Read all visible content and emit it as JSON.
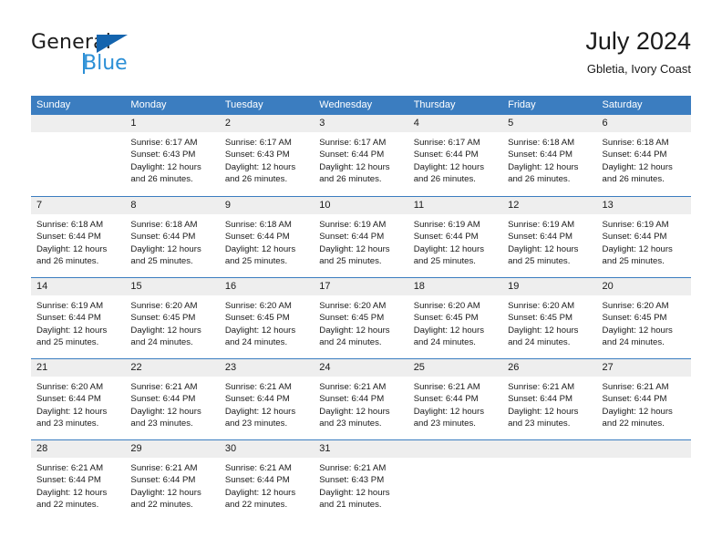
{
  "brand": {
    "name_top": "General",
    "name_bottom": "Blue",
    "accent_color": "#1464ae",
    "accent_color_light": "#2b8fd6"
  },
  "header": {
    "title": "July 2024",
    "subtitle": "Gbletia, Ivory Coast"
  },
  "calendar": {
    "header_color": "#3b7dc0",
    "day_band_color": "#eeeeee",
    "weekdays": [
      "Sunday",
      "Monday",
      "Tuesday",
      "Wednesday",
      "Thursday",
      "Friday",
      "Saturday"
    ],
    "weeks": [
      [
        {
          "day": "",
          "sunrise": "",
          "sunset": "",
          "daylight_line1": "",
          "daylight_line2": ""
        },
        {
          "day": "1",
          "sunrise": "Sunrise: 6:17 AM",
          "sunset": "Sunset: 6:43 PM",
          "daylight_line1": "Daylight: 12 hours",
          "daylight_line2": "and 26 minutes."
        },
        {
          "day": "2",
          "sunrise": "Sunrise: 6:17 AM",
          "sunset": "Sunset: 6:43 PM",
          "daylight_line1": "Daylight: 12 hours",
          "daylight_line2": "and 26 minutes."
        },
        {
          "day": "3",
          "sunrise": "Sunrise: 6:17 AM",
          "sunset": "Sunset: 6:44 PM",
          "daylight_line1": "Daylight: 12 hours",
          "daylight_line2": "and 26 minutes."
        },
        {
          "day": "4",
          "sunrise": "Sunrise: 6:17 AM",
          "sunset": "Sunset: 6:44 PM",
          "daylight_line1": "Daylight: 12 hours",
          "daylight_line2": "and 26 minutes."
        },
        {
          "day": "5",
          "sunrise": "Sunrise: 6:18 AM",
          "sunset": "Sunset: 6:44 PM",
          "daylight_line1": "Daylight: 12 hours",
          "daylight_line2": "and 26 minutes."
        },
        {
          "day": "6",
          "sunrise": "Sunrise: 6:18 AM",
          "sunset": "Sunset: 6:44 PM",
          "daylight_line1": "Daylight: 12 hours",
          "daylight_line2": "and 26 minutes."
        }
      ],
      [
        {
          "day": "7",
          "sunrise": "Sunrise: 6:18 AM",
          "sunset": "Sunset: 6:44 PM",
          "daylight_line1": "Daylight: 12 hours",
          "daylight_line2": "and 26 minutes."
        },
        {
          "day": "8",
          "sunrise": "Sunrise: 6:18 AM",
          "sunset": "Sunset: 6:44 PM",
          "daylight_line1": "Daylight: 12 hours",
          "daylight_line2": "and 25 minutes."
        },
        {
          "day": "9",
          "sunrise": "Sunrise: 6:18 AM",
          "sunset": "Sunset: 6:44 PM",
          "daylight_line1": "Daylight: 12 hours",
          "daylight_line2": "and 25 minutes."
        },
        {
          "day": "10",
          "sunrise": "Sunrise: 6:19 AM",
          "sunset": "Sunset: 6:44 PM",
          "daylight_line1": "Daylight: 12 hours",
          "daylight_line2": "and 25 minutes."
        },
        {
          "day": "11",
          "sunrise": "Sunrise: 6:19 AM",
          "sunset": "Sunset: 6:44 PM",
          "daylight_line1": "Daylight: 12 hours",
          "daylight_line2": "and 25 minutes."
        },
        {
          "day": "12",
          "sunrise": "Sunrise: 6:19 AM",
          "sunset": "Sunset: 6:44 PM",
          "daylight_line1": "Daylight: 12 hours",
          "daylight_line2": "and 25 minutes."
        },
        {
          "day": "13",
          "sunrise": "Sunrise: 6:19 AM",
          "sunset": "Sunset: 6:44 PM",
          "daylight_line1": "Daylight: 12 hours",
          "daylight_line2": "and 25 minutes."
        }
      ],
      [
        {
          "day": "14",
          "sunrise": "Sunrise: 6:19 AM",
          "sunset": "Sunset: 6:44 PM",
          "daylight_line1": "Daylight: 12 hours",
          "daylight_line2": "and 25 minutes."
        },
        {
          "day": "15",
          "sunrise": "Sunrise: 6:20 AM",
          "sunset": "Sunset: 6:45 PM",
          "daylight_line1": "Daylight: 12 hours",
          "daylight_line2": "and 24 minutes."
        },
        {
          "day": "16",
          "sunrise": "Sunrise: 6:20 AM",
          "sunset": "Sunset: 6:45 PM",
          "daylight_line1": "Daylight: 12 hours",
          "daylight_line2": "and 24 minutes."
        },
        {
          "day": "17",
          "sunrise": "Sunrise: 6:20 AM",
          "sunset": "Sunset: 6:45 PM",
          "daylight_line1": "Daylight: 12 hours",
          "daylight_line2": "and 24 minutes."
        },
        {
          "day": "18",
          "sunrise": "Sunrise: 6:20 AM",
          "sunset": "Sunset: 6:45 PM",
          "daylight_line1": "Daylight: 12 hours",
          "daylight_line2": "and 24 minutes."
        },
        {
          "day": "19",
          "sunrise": "Sunrise: 6:20 AM",
          "sunset": "Sunset: 6:45 PM",
          "daylight_line1": "Daylight: 12 hours",
          "daylight_line2": "and 24 minutes."
        },
        {
          "day": "20",
          "sunrise": "Sunrise: 6:20 AM",
          "sunset": "Sunset: 6:45 PM",
          "daylight_line1": "Daylight: 12 hours",
          "daylight_line2": "and 24 minutes."
        }
      ],
      [
        {
          "day": "21",
          "sunrise": "Sunrise: 6:20 AM",
          "sunset": "Sunset: 6:44 PM",
          "daylight_line1": "Daylight: 12 hours",
          "daylight_line2": "and 23 minutes."
        },
        {
          "day": "22",
          "sunrise": "Sunrise: 6:21 AM",
          "sunset": "Sunset: 6:44 PM",
          "daylight_line1": "Daylight: 12 hours",
          "daylight_line2": "and 23 minutes."
        },
        {
          "day": "23",
          "sunrise": "Sunrise: 6:21 AM",
          "sunset": "Sunset: 6:44 PM",
          "daylight_line1": "Daylight: 12 hours",
          "daylight_line2": "and 23 minutes."
        },
        {
          "day": "24",
          "sunrise": "Sunrise: 6:21 AM",
          "sunset": "Sunset: 6:44 PM",
          "daylight_line1": "Daylight: 12 hours",
          "daylight_line2": "and 23 minutes."
        },
        {
          "day": "25",
          "sunrise": "Sunrise: 6:21 AM",
          "sunset": "Sunset: 6:44 PM",
          "daylight_line1": "Daylight: 12 hours",
          "daylight_line2": "and 23 minutes."
        },
        {
          "day": "26",
          "sunrise": "Sunrise: 6:21 AM",
          "sunset": "Sunset: 6:44 PM",
          "daylight_line1": "Daylight: 12 hours",
          "daylight_line2": "and 23 minutes."
        },
        {
          "day": "27",
          "sunrise": "Sunrise: 6:21 AM",
          "sunset": "Sunset: 6:44 PM",
          "daylight_line1": "Daylight: 12 hours",
          "daylight_line2": "and 22 minutes."
        }
      ],
      [
        {
          "day": "28",
          "sunrise": "Sunrise: 6:21 AM",
          "sunset": "Sunset: 6:44 PM",
          "daylight_line1": "Daylight: 12 hours",
          "daylight_line2": "and 22 minutes."
        },
        {
          "day": "29",
          "sunrise": "Sunrise: 6:21 AM",
          "sunset": "Sunset: 6:44 PM",
          "daylight_line1": "Daylight: 12 hours",
          "daylight_line2": "and 22 minutes."
        },
        {
          "day": "30",
          "sunrise": "Sunrise: 6:21 AM",
          "sunset": "Sunset: 6:44 PM",
          "daylight_line1": "Daylight: 12 hours",
          "daylight_line2": "and 22 minutes."
        },
        {
          "day": "31",
          "sunrise": "Sunrise: 6:21 AM",
          "sunset": "Sunset: 6:43 PM",
          "daylight_line1": "Daylight: 12 hours",
          "daylight_line2": "and 21 minutes."
        },
        {
          "day": "",
          "sunrise": "",
          "sunset": "",
          "daylight_line1": "",
          "daylight_line2": ""
        },
        {
          "day": "",
          "sunrise": "",
          "sunset": "",
          "daylight_line1": "",
          "daylight_line2": ""
        },
        {
          "day": "",
          "sunrise": "",
          "sunset": "",
          "daylight_line1": "",
          "daylight_line2": ""
        }
      ]
    ]
  }
}
